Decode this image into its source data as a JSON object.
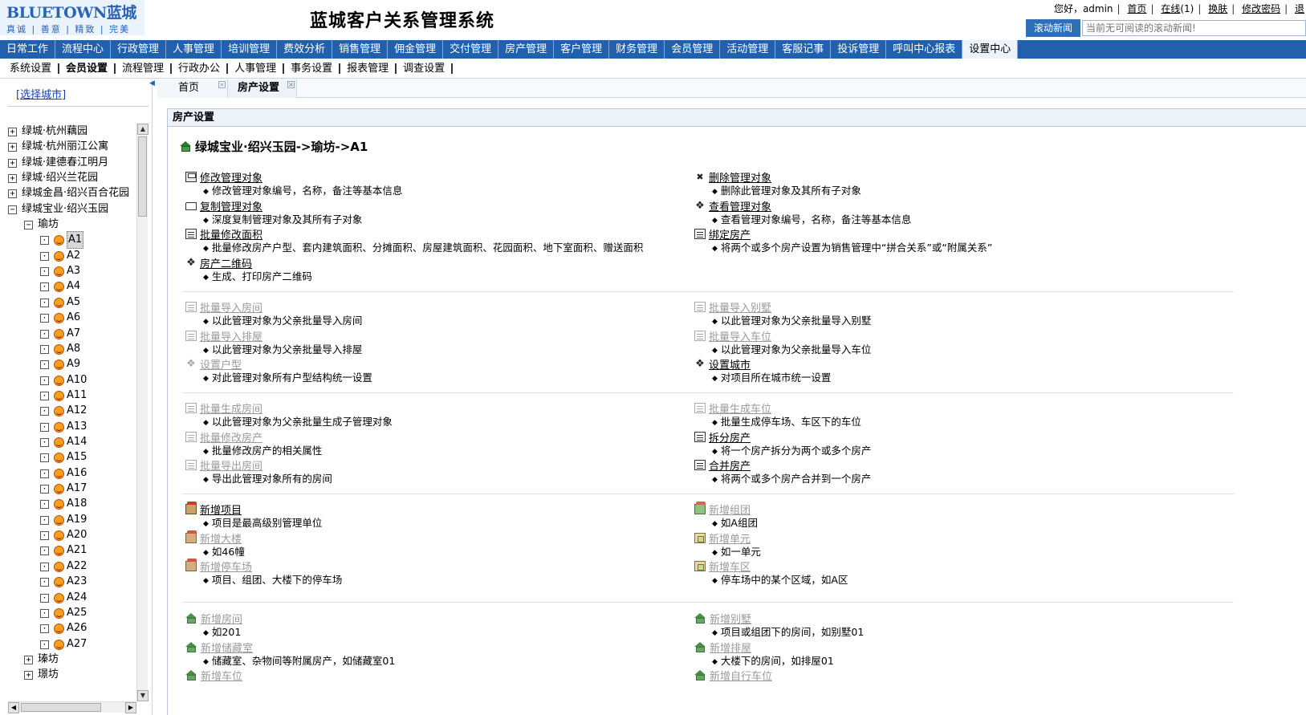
{
  "header": {
    "logo_text": "BLUETOWN蓝城",
    "logo_slogan": "真诚 | 善意 | 精致 | 完美",
    "system_title": "蓝城客户关系管理系统",
    "greeting": "您好，admin",
    "link_home": "首页",
    "link_online": "在线",
    "online_count": "(1)",
    "link_skin": "换肤",
    "link_password": "修改密码",
    "link_more": "退",
    "news_label": "滚动新闻",
    "news_placeholder": "当前无可阅读的滚动新闻!"
  },
  "main_nav": [
    {
      "label": "日常工作"
    },
    {
      "label": "流程中心"
    },
    {
      "label": "行政管理"
    },
    {
      "label": "人事管理"
    },
    {
      "label": "培训管理"
    },
    {
      "label": "费效分析"
    },
    {
      "label": "销售管理"
    },
    {
      "label": "佣金管理"
    },
    {
      "label": "交付管理"
    },
    {
      "label": "房产管理"
    },
    {
      "label": "客户管理"
    },
    {
      "label": "财务管理"
    },
    {
      "label": "会员管理"
    },
    {
      "label": "活动管理"
    },
    {
      "label": "客服记事"
    },
    {
      "label": "投诉管理"
    },
    {
      "label": "呼叫中心报表"
    },
    {
      "label": "设置中心",
      "active": true
    }
  ],
  "sub_nav": [
    {
      "label": "系统设置"
    },
    {
      "label": "会员设置",
      "active": true
    },
    {
      "label": "流程管理"
    },
    {
      "label": "行政办公"
    },
    {
      "label": "人事管理"
    },
    {
      "label": "事务设置"
    },
    {
      "label": "报表管理"
    },
    {
      "label": "调查设置"
    }
  ],
  "left": {
    "select_city": "[选择城市]",
    "tree_projects": [
      {
        "label": "绿城·杭州藕园",
        "expanded": false
      },
      {
        "label": "绿城·杭州丽江公寓",
        "expanded": false
      },
      {
        "label": "绿城·建德春江明月",
        "expanded": false
      },
      {
        "label": "绿城·绍兴兰花园",
        "expanded": false
      },
      {
        "label": "绿城金昌·绍兴百合花园",
        "expanded": false
      },
      {
        "label": "绿城宝业·绍兴玉园",
        "expanded": true
      }
    ],
    "group_expanded": "瑜坊",
    "leaves": [
      "A1",
      "A2",
      "A3",
      "A4",
      "A5",
      "A6",
      "A7",
      "A8",
      "A9",
      "A10",
      "A11",
      "A12",
      "A13",
      "A14",
      "A15",
      "A16",
      "A17",
      "A18",
      "A19",
      "A20",
      "A21",
      "A22",
      "A23",
      "A24",
      "A25",
      "A26",
      "A27"
    ],
    "selected_leaf": "A1",
    "groups_collapsed": [
      "瑧坊",
      "璟坊"
    ]
  },
  "tabs": [
    {
      "label": "首页",
      "active": false
    },
    {
      "label": "房产设置",
      "active": true
    }
  ],
  "content": {
    "header": "房产设置",
    "breadcrumb": "绿城宝业·绍兴玉园->瑜坊->A1",
    "sections": [
      {
        "left": [
          {
            "title": "修改管理对象",
            "desc": "修改管理对象编号，名称，备注等基本信息",
            "icon": "save-icon",
            "enabled": true
          },
          {
            "title": "复制管理对象",
            "desc": "深度复制管理对象及其所有子对象",
            "icon": "folder-icon",
            "enabled": true
          },
          {
            "title": "批量修改面积",
            "desc": "批量修改房产户型、套内建筑面积、分摊面积、房屋建筑面积、花园面积、地下室面积、赠送面积",
            "icon": "document-icon",
            "enabled": true
          },
          {
            "title": "房产二维码",
            "desc": "生成、打印房产二维码",
            "icon": "gear-icon",
            "enabled": true
          }
        ],
        "right": [
          {
            "title": "删除管理对象",
            "desc": "删除此管理对象及其所有子对象",
            "icon": "delete-icon",
            "enabled": true
          },
          {
            "title": "查看管理对象",
            "desc": "查看管理对象编号，名称，备注等基本信息",
            "icon": "gear-icon",
            "enabled": true
          },
          {
            "title": "绑定房产",
            "desc": "将两个或多个房产设置为销售管理中“拼合关系”或“附属关系”",
            "icon": "document-icon",
            "enabled": true
          }
        ]
      },
      {
        "left": [
          {
            "title": "批量导入房间",
            "desc": "以此管理对象为父亲批量导入房间",
            "icon": "document-icon",
            "enabled": false
          },
          {
            "title": "批量导入排屋",
            "desc": "以此管理对象为父亲批量导入排屋",
            "icon": "document-icon",
            "enabled": false
          },
          {
            "title": "设置户型",
            "desc": "对此管理对象所有户型结构统一设置",
            "icon": "gear-icon",
            "enabled": false
          }
        ],
        "right": [
          {
            "title": "批量导入别墅",
            "desc": "以此管理对象为父亲批量导入别墅",
            "icon": "document-icon",
            "enabled": false
          },
          {
            "title": "批量导入车位",
            "desc": "以此管理对象为父亲批量导入车位",
            "icon": "document-icon",
            "enabled": false
          },
          {
            "title": "设置城市",
            "desc": "对项目所在城市统一设置",
            "icon": "gear-icon",
            "enabled": true
          }
        ]
      },
      {
        "left": [
          {
            "title": "批量生成房间",
            "desc": "以此管理对象为父亲批量生成子管理对象",
            "icon": "document-icon",
            "enabled": false
          },
          {
            "title": "批量修改房产",
            "desc": "批量修改房产的相关属性",
            "icon": "document-icon",
            "enabled": false
          },
          {
            "title": "批量导出房间",
            "desc": "导出此管理对象所有的房间",
            "icon": "document-icon",
            "enabled": false
          }
        ],
        "right": [
          {
            "title": "批量生成车位",
            "desc": "批量生成停车场、车区下的车位",
            "icon": "document-icon",
            "enabled": false
          },
          {
            "title": "拆分房产",
            "desc": "将一个房产拆分为两个或多个房产",
            "icon": "document-icon",
            "enabled": true
          },
          {
            "title": "合并房产",
            "desc": "将两个或多个房产合并到一个房产",
            "icon": "document-icon",
            "enabled": true
          }
        ]
      },
      {
        "left": [
          {
            "title": "新增项目",
            "desc": "项目是最高级别管理单位",
            "icon": "project-icon",
            "enabled": true
          },
          {
            "title": "新增大楼",
            "desc": "如46幢",
            "icon": "building-icon",
            "enabled": false
          },
          {
            "title": "新增停车场",
            "desc": "项目、组团、大楼下的停车场",
            "icon": "building-icon",
            "enabled": false
          }
        ],
        "right": [
          {
            "title": "新增组团",
            "desc": "如A组团",
            "icon": "group-icon",
            "enabled": false
          },
          {
            "title": "新增单元",
            "desc": "如一单元",
            "icon": "cube-icon",
            "enabled": false
          },
          {
            "title": "新增车区",
            "desc": "停车场中的某个区域，如A区",
            "icon": "cube-icon",
            "enabled": false
          }
        ]
      },
      {
        "left": [
          {
            "title": "新增房间",
            "desc": "如201",
            "icon": "house-icon",
            "enabled": false
          },
          {
            "title": "新增储藏室",
            "desc": "储藏室、杂物间等附属房产，如储藏室01",
            "icon": "house-icon",
            "enabled": false
          },
          {
            "title": "新增车位",
            "desc": "",
            "icon": "house-icon",
            "enabled": false
          }
        ],
        "right": [
          {
            "title": "新增别墅",
            "desc": "项目或组团下的房间，如别墅01",
            "icon": "house-icon",
            "enabled": false
          },
          {
            "title": "新增排屋",
            "desc": "大楼下的房间，如排屋01",
            "icon": "house-icon",
            "enabled": false
          },
          {
            "title": "新增自行车位",
            "desc": "",
            "icon": "house-icon",
            "enabled": false
          }
        ]
      }
    ]
  }
}
